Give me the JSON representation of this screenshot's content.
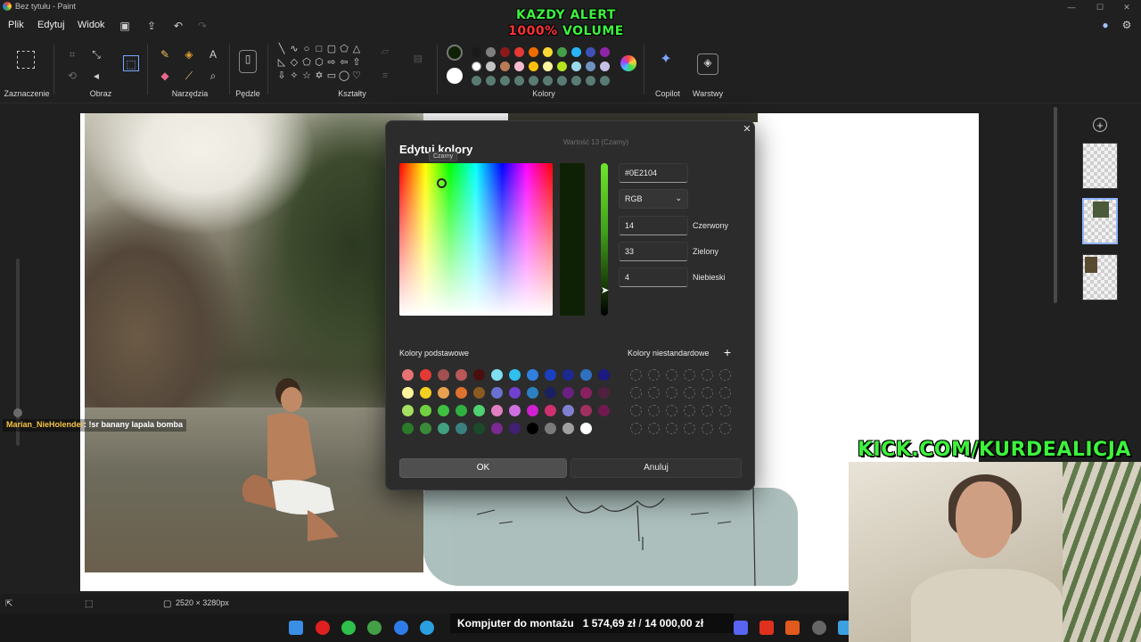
{
  "window": {
    "title": "Bez tytułu - Paint"
  },
  "menu": {
    "items": [
      "Plik",
      "Edytuj",
      "Widok"
    ]
  },
  "overlay": {
    "alert_line1": "KAZDY ALERT",
    "alert_pct": "1000%",
    "alert_rest": " VOLUME",
    "kick": "KICK.COM/KURDEALICJA",
    "chat_user": "Marian_NieHolender",
    "chat_message": ": !sr banany lapala bomba"
  },
  "ribbon": {
    "groups": [
      "Zaznaczenie",
      "Obraz",
      "Narzędzia",
      "Pędzle",
      "Kształty",
      "Kolory",
      "Copilot",
      "Warstwy"
    ]
  },
  "palette": {
    "row1": [
      "#1a1a1a",
      "#7f7f7f",
      "#8b1a1a",
      "#e53935",
      "#ef6c00",
      "#fdd835",
      "#43a047",
      "#29b6f6",
      "#3f51b5",
      "#8e24aa"
    ],
    "row2": [
      "#ffffff",
      "#c3c3c3",
      "#b97a57",
      "#f8bbd0",
      "#ffc107",
      "#fff59d",
      "#b5e61d",
      "#99d9ea",
      "#7092be",
      "#c8bfe7"
    ],
    "row3": [
      "#5a7b73",
      "#5a7b73",
      "#5a7b73",
      "#5a7b73",
      "#5a7b73",
      "#5a7b73",
      "#5a7b73",
      "#5a7b73",
      "#5a7b73",
      "#5a7b73"
    ],
    "primary": "#0e2104",
    "secondary": "#ffffff"
  },
  "dialog": {
    "title": "Edytuj kolory",
    "hint": "Wartość 13 (Czarny)",
    "tooltip": "Czarny",
    "hex": "#0E2104",
    "mode": "RGB",
    "fields": [
      {
        "value": "14",
        "label": "Czerwony"
      },
      {
        "value": "33",
        "label": "Zielony"
      },
      {
        "value": "4",
        "label": "Niebieski"
      }
    ],
    "basic_label": "Kolory podstawowe",
    "custom_label": "Kolory niestandardowe",
    "ok": "OK",
    "cancel": "Anuluj",
    "basic_colors": [
      [
        "#e57373",
        "#e53935",
        "#a05050",
        "#b85858",
        "#4a1010",
        "#7ee0f0",
        "#30c0f0",
        "#3080e0",
        "#1a40c0",
        "#1a2a90",
        "#3070c0",
        "#1a1a80"
      ],
      [
        "#fff59d",
        "#f5d020",
        "#e8a050",
        "#e07030",
        "#8a5a20",
        "#6a70d0",
        "#7040d0",
        "#2a80c0",
        "#1a2060",
        "#6a2080",
        "#8a2060",
        "#502040"
      ],
      [
        "#a5e060",
        "#70d040",
        "#40c040",
        "#30b040",
        "#50d070",
        "#e080c0",
        "#d070e0",
        "#d020d0",
        "#d03070",
        "#8080d0",
        "#a03060",
        "#701a50"
      ],
      [
        "#2a7a2a",
        "#3a8a3a",
        "#40a080",
        "#3a8080",
        "#1a4a2a",
        "#7a2a90",
        "#402070",
        "#000000",
        "#7a7a7a",
        "#a0a0a0",
        "#ffffff"
      ]
    ]
  },
  "status": {
    "dimensions": "2520 × 3280px"
  },
  "goal": {
    "label": "Kompjuter do montażu",
    "current": "1 574,69 zł",
    "target": "14 000,00 zł"
  }
}
